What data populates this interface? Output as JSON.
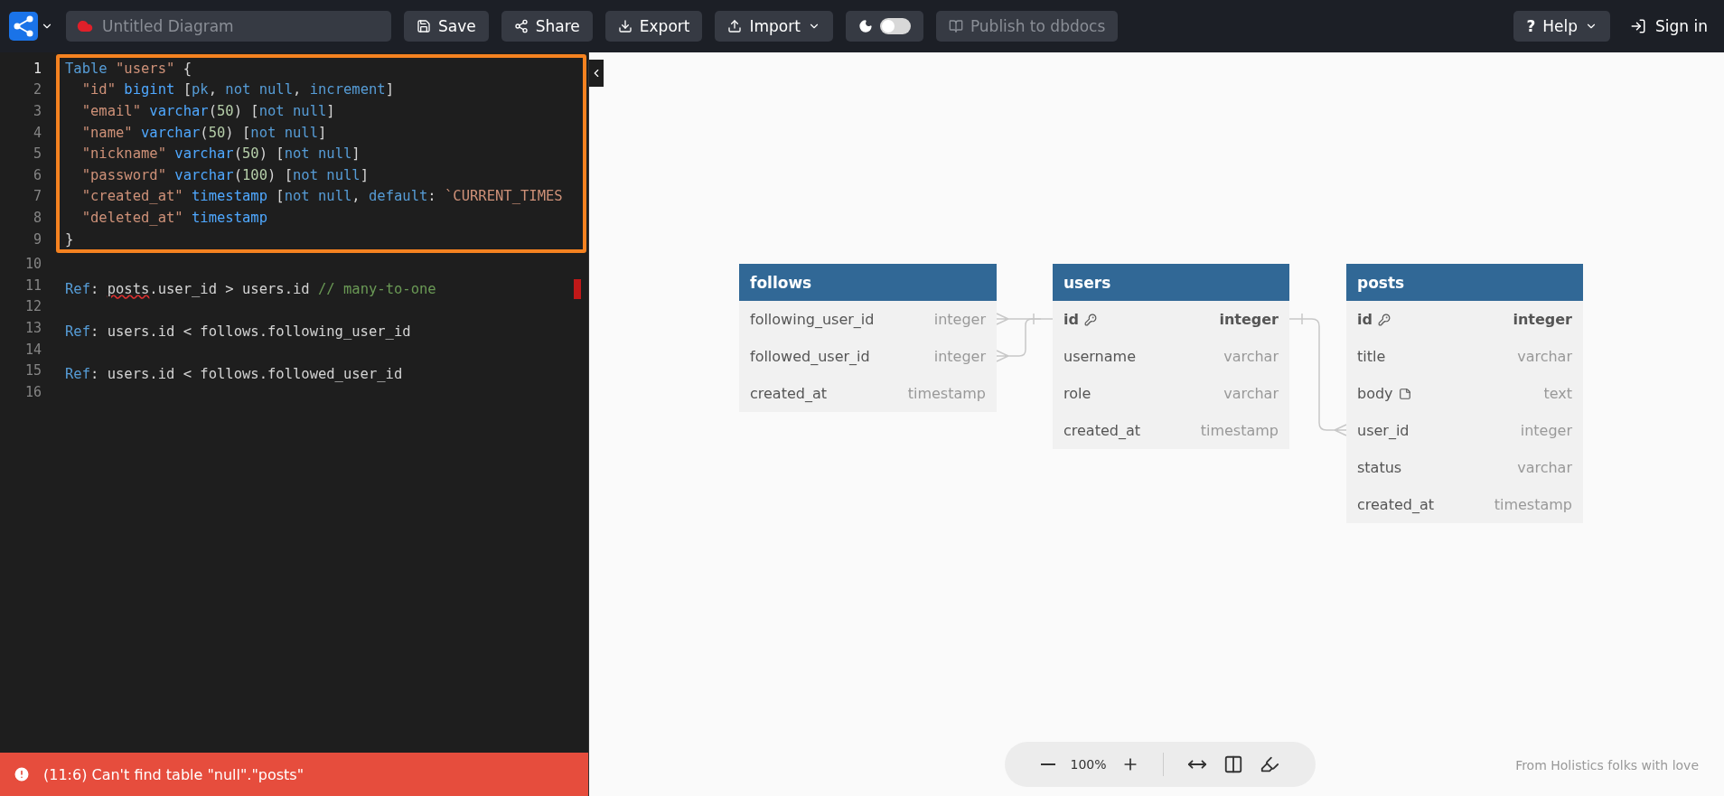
{
  "toolbar": {
    "diagram_name_placeholder": "Untitled Diagram",
    "buttons": [
      {
        "kind": "save",
        "label": "Save",
        "menu": false
      },
      {
        "kind": "share",
        "label": "Share",
        "menu": false
      },
      {
        "kind": "export",
        "label": "Export",
        "menu": false
      },
      {
        "kind": "import",
        "label": "Import",
        "menu": true
      }
    ],
    "dark_mode": {
      "on": false
    },
    "publish": {
      "label": "Publish to dbdocs",
      "disabled": true
    },
    "help": {
      "icon": "?",
      "label": "Help"
    },
    "sign_in": {
      "label": "Sign in"
    }
  },
  "editor": {
    "blocks": [
      {
        "highlighted": true,
        "lines": [
          {
            "number": "1",
            "active": true,
            "tokens": [
              {
                "color": "#569cd6",
                "t": "Table"
              },
              {
                "color": "#ce9178",
                "t": " \"users\""
              },
              {
                "color": "#d4d4d4",
                "t": " {"
              }
            ]
          },
          {
            "number": "2",
            "active": false,
            "tokens": [
              {
                "color": "#ce9178",
                "t": "  \"id\""
              },
              {
                "color": "#4fa8ff",
                "t": " bigint"
              },
              {
                "color": "#d4d4d4",
                "t": " ["
              },
              {
                "color": "#569cd6",
                "t": "pk"
              },
              {
                "color": "#d4d4d4",
                "t": ", "
              },
              {
                "color": "#569cd6",
                "t": "not null"
              },
              {
                "color": "#d4d4d4",
                "t": ", "
              },
              {
                "color": "#569cd6",
                "t": "increment"
              },
              {
                "color": "#d4d4d4",
                "t": "]"
              }
            ]
          },
          {
            "number": "3",
            "active": false,
            "tokens": [
              {
                "color": "#ce9178",
                "t": "  \"email\""
              },
              {
                "color": "#4fa8ff",
                "t": " varchar"
              },
              {
                "color": "#d4d4d4",
                "t": "("
              },
              {
                "color": "#b5cea8",
                "t": "50"
              },
              {
                "color": "#d4d4d4",
                "t": ") ["
              },
              {
                "color": "#569cd6",
                "t": "not null"
              },
              {
                "color": "#d4d4d4",
                "t": "]"
              }
            ]
          },
          {
            "number": "4",
            "active": false,
            "tokens": [
              {
                "color": "#ce9178",
                "t": "  \"name\""
              },
              {
                "color": "#4fa8ff",
                "t": " varchar"
              },
              {
                "color": "#d4d4d4",
                "t": "("
              },
              {
                "color": "#b5cea8",
                "t": "50"
              },
              {
                "color": "#d4d4d4",
                "t": ") ["
              },
              {
                "color": "#569cd6",
                "t": "not null"
              },
              {
                "color": "#d4d4d4",
                "t": "]"
              }
            ]
          },
          {
            "number": "5",
            "active": false,
            "tokens": [
              {
                "color": "#ce9178",
                "t": "  \"nickname\""
              },
              {
                "color": "#4fa8ff",
                "t": " varchar"
              },
              {
                "color": "#d4d4d4",
                "t": "("
              },
              {
                "color": "#b5cea8",
                "t": "50"
              },
              {
                "color": "#d4d4d4",
                "t": ") ["
              },
              {
                "color": "#569cd6",
                "t": "not null"
              },
              {
                "color": "#d4d4d4",
                "t": "]"
              }
            ]
          },
          {
            "number": "6",
            "active": false,
            "tokens": [
              {
                "color": "#ce9178",
                "t": "  \"password\""
              },
              {
                "color": "#4fa8ff",
                "t": " varchar"
              },
              {
                "color": "#d4d4d4",
                "t": "("
              },
              {
                "color": "#b5cea8",
                "t": "100"
              },
              {
                "color": "#d4d4d4",
                "t": ") ["
              },
              {
                "color": "#569cd6",
                "t": "not null"
              },
              {
                "color": "#d4d4d4",
                "t": "]"
              }
            ]
          },
          {
            "number": "7",
            "active": false,
            "tokens": [
              {
                "color": "#ce9178",
                "t": "  \"created_at\""
              },
              {
                "color": "#4fa8ff",
                "t": " timestamp"
              },
              {
                "color": "#d4d4d4",
                "t": " ["
              },
              {
                "color": "#569cd6",
                "t": "not null"
              },
              {
                "color": "#d4d4d4",
                "t": ", "
              },
              {
                "color": "#569cd6",
                "t": "default"
              },
              {
                "color": "#d4d4d4",
                "t": ":"
              },
              {
                "color": "#ce9178",
                "t": " `CURRENT_TIMES"
              }
            ]
          },
          {
            "number": "8",
            "active": false,
            "tokens": [
              {
                "color": "#ce9178",
                "t": "  \"deleted_at\""
              },
              {
                "color": "#4fa8ff",
                "t": " timestamp"
              }
            ]
          },
          {
            "number": "9",
            "active": false,
            "tokens": [
              {
                "color": "#d4d4d4",
                "t": "}"
              }
            ]
          }
        ]
      },
      {
        "highlighted": false,
        "lines": [
          {
            "number": "10",
            "active": false
          },
          {
            "number": "11",
            "active": false,
            "error_marker": true,
            "tokens": [
              {
                "color": "#569cd6",
                "t": "Ref"
              },
              {
                "color": "#d4d4d4",
                "t": ": "
              },
              {
                "color": "#d4d4d4",
                "t": "posts",
                "error": true
              },
              {
                "color": "#d4d4d4",
                "t": ".user_id > users.id"
              },
              {
                "color": "#6a9955",
                "t": " // many-to-one"
              }
            ]
          },
          {
            "number": "12",
            "active": false
          },
          {
            "number": "13",
            "active": false,
            "tokens": [
              {
                "color": "#569cd6",
                "t": "Ref"
              },
              {
                "color": "#d4d4d4",
                "t": ": users.id < follows.following_user_id"
              }
            ]
          },
          {
            "number": "14",
            "active": false
          },
          {
            "number": "15",
            "active": false,
            "tokens": [
              {
                "color": "#569cd6",
                "t": "Ref"
              },
              {
                "color": "#d4d4d4",
                "t": ": users.id < follows.followed_user_id"
              }
            ]
          },
          {
            "number": "16",
            "active": false
          }
        ]
      }
    ],
    "error": "(11:6) Can't find table \"null\".\"posts\""
  },
  "diagram": {
    "tables": [
      {
        "name": "follows",
        "fields": [
          {
            "name": "following_user_id",
            "type": "integer",
            "pk": false,
            "note": false
          },
          {
            "name": "followed_user_id",
            "type": "integer",
            "pk": false,
            "note": false
          },
          {
            "name": "created_at",
            "type": "timestamp",
            "pk": false,
            "note": false
          }
        ]
      },
      {
        "name": "users",
        "fields": [
          {
            "name": "id",
            "type": "integer",
            "pk": true,
            "note": false
          },
          {
            "name": "username",
            "type": "varchar",
            "pk": false,
            "note": false
          },
          {
            "name": "role",
            "type": "varchar",
            "pk": false,
            "note": false
          },
          {
            "name": "created_at",
            "type": "timestamp",
            "pk": false,
            "note": false
          }
        ]
      },
      {
        "name": "posts",
        "fields": [
          {
            "name": "id",
            "type": "integer",
            "pk": true,
            "note": false
          },
          {
            "name": "title",
            "type": "varchar",
            "pk": false,
            "note": false
          },
          {
            "name": "body",
            "type": "text",
            "pk": false,
            "note": true
          },
          {
            "name": "user_id",
            "type": "integer",
            "pk": false,
            "note": false
          },
          {
            "name": "status",
            "type": "varchar",
            "pk": false,
            "note": false
          },
          {
            "name": "created_at",
            "type": "timestamp",
            "pk": false,
            "note": false
          }
        ]
      }
    ],
    "zoom": "100%",
    "credit": "From Holistics folks with love"
  }
}
